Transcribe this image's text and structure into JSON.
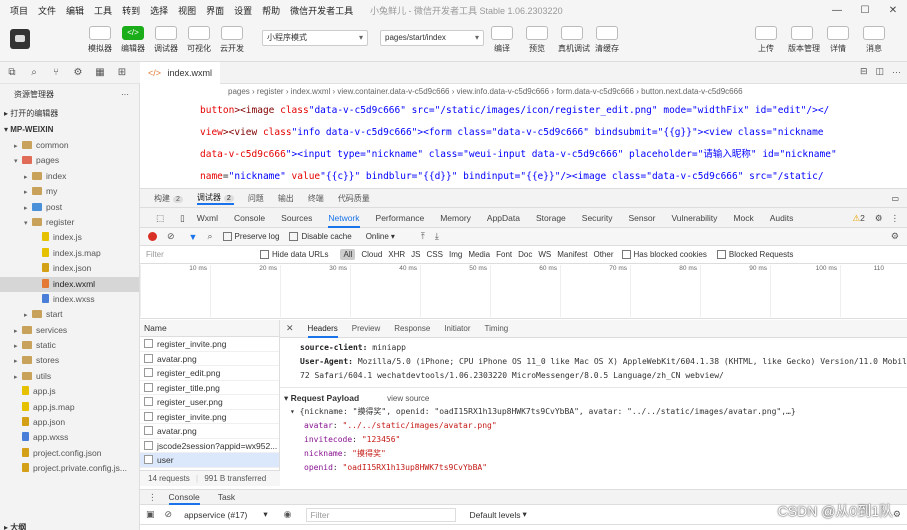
{
  "menu": [
    "项目",
    "文件",
    "编辑",
    "工具",
    "转到",
    "选择",
    "视图",
    "界面",
    "设置",
    "帮助",
    "微信开发者工具"
  ],
  "window_title": "小兔鲜儿 - 微信开发者工具 Stable 1.06.2303220",
  "toolbar": {
    "left_buttons": [
      {
        "label": "模拟器",
        "icon": "phone-icon"
      },
      {
        "label": "编辑器",
        "icon": "code-icon"
      },
      {
        "label": "调试器",
        "icon": "debug-icon"
      },
      {
        "label": "可视化",
        "icon": "visual-icon"
      },
      {
        "label": "云开发",
        "icon": "cloud-icon"
      }
    ],
    "mode_select": "小程序模式",
    "page_select": "pages/start/index",
    "mid_buttons": [
      {
        "label": "编译"
      },
      {
        "label": "预览"
      },
      {
        "label": "真机调试"
      },
      {
        "label": "清缓存"
      }
    ],
    "right_buttons": [
      {
        "label": "上传"
      },
      {
        "label": "版本管理"
      },
      {
        "label": "详情"
      },
      {
        "label": "消息"
      }
    ]
  },
  "sidebar": {
    "title": "资源管理器",
    "open_editors": "打开的编辑器",
    "project": "MP-WEIXIN",
    "tree": [
      {
        "label": "common",
        "indent": 1,
        "type": "folder",
        "arrow": "▸"
      },
      {
        "label": "pages",
        "indent": 1,
        "type": "folder-red",
        "arrow": "▾"
      },
      {
        "label": "index",
        "indent": 2,
        "type": "folder",
        "arrow": "▸"
      },
      {
        "label": "my",
        "indent": 2,
        "type": "folder",
        "arrow": "▸"
      },
      {
        "label": "post",
        "indent": 2,
        "type": "folder-blue",
        "arrow": "▸"
      },
      {
        "label": "register",
        "indent": 2,
        "type": "folder",
        "arrow": "▾"
      },
      {
        "label": "index.js",
        "indent": 3,
        "type": "js",
        "arrow": ""
      },
      {
        "label": "index.js.map",
        "indent": 3,
        "type": "js",
        "arrow": ""
      },
      {
        "label": "index.json",
        "indent": 3,
        "type": "json",
        "arrow": ""
      },
      {
        "label": "index.wxml",
        "indent": 3,
        "type": "wxml",
        "arrow": "",
        "active": true
      },
      {
        "label": "index.wxss",
        "indent": 3,
        "type": "wxss",
        "arrow": ""
      },
      {
        "label": "start",
        "indent": 2,
        "type": "folder",
        "arrow": "▸"
      },
      {
        "label": "services",
        "indent": 1,
        "type": "folder",
        "arrow": "▸"
      },
      {
        "label": "static",
        "indent": 1,
        "type": "folder",
        "arrow": "▸"
      },
      {
        "label": "stores",
        "indent": 1,
        "type": "folder",
        "arrow": "▸"
      },
      {
        "label": "utils",
        "indent": 1,
        "type": "folder",
        "arrow": "▸"
      },
      {
        "label": "app.js",
        "indent": 1,
        "type": "js",
        "arrow": ""
      },
      {
        "label": "app.js.map",
        "indent": 1,
        "type": "js",
        "arrow": ""
      },
      {
        "label": "app.json",
        "indent": 1,
        "type": "json",
        "arrow": ""
      },
      {
        "label": "app.wxss",
        "indent": 1,
        "type": "wxss",
        "arrow": ""
      },
      {
        "label": "project.config.json",
        "indent": 1,
        "type": "json",
        "arrow": ""
      },
      {
        "label": "project.private.config.js...",
        "indent": 1,
        "type": "json",
        "arrow": ""
      }
    ],
    "bottom": "大纲"
  },
  "editor": {
    "tab": "index.wxml",
    "breadcrumb": [
      "pages",
      "register",
      "index.wxml",
      "view.container.data-v-c5d9c666",
      "view.info.data-v-c5d9c666",
      "form.data-v-c5d9c666",
      "button.next.data-v-c5d9c666"
    ],
    "code_lines": [
      "button><image class=\"data-v-c5d9c666\" src=\"/static/images/icon/register_edit.png\" mode=\"widthFix\" id=\"edit\"/></",
      "view><view class=\"info data-v-c5d9c666\"><form class=\"data-v-c5d9c666\" bindsubmit=\"{{g}}\"><view class=\"nickname",
      "data-v-c5d9c666\"><input type=\"nickname\" class=\"weui-input data-v-c5d9c666\" placeholder=\"请输入昵称\" id=\"nickname\"",
      "name=\"nickname\" value=\"{{c}}\" bindblur=\"{{d}}\" bindinput=\"{{e}}\"/><image class=\"data-v-c5d9c666\" src=\"/static/"
    ]
  },
  "devtools": {
    "top_tabs": [
      {
        "label": "构建",
        "badge": "2"
      },
      {
        "label": "调试器",
        "badge": "2"
      },
      {
        "label": "问题",
        "badge": ""
      },
      {
        "label": "输出",
        "badge": ""
      },
      {
        "label": "终端",
        "badge": ""
      },
      {
        "label": "代码质量",
        "badge": ""
      }
    ],
    "panel_tabs": [
      "Wxml",
      "Console",
      "Sources",
      "Network",
      "Performance",
      "Memory",
      "AppData",
      "Storage",
      "Security",
      "Sensor",
      "Vulnerability",
      "Mock",
      "Audits"
    ],
    "active_panel": "Network",
    "warnings": "2",
    "net_toolbar": {
      "preserve_log": "Preserve log",
      "disable_cache": "Disable cache",
      "throttle": "Online"
    },
    "filter": {
      "placeholder": "Filter",
      "hide_data_urls": "Hide data URLs",
      "types": [
        "All",
        "Cloud",
        "XHR",
        "JS",
        "CSS",
        "Img",
        "Media",
        "Font",
        "Doc",
        "WS",
        "Manifest",
        "Other"
      ],
      "blocked_cookies": "Has blocked cookies",
      "blocked_requests": "Blocked Requests"
    },
    "timeline_ticks": [
      "10 ms",
      "20 ms",
      "30 ms",
      "40 ms",
      "50 ms",
      "60 ms",
      "70 ms",
      "80 ms",
      "90 ms",
      "100 ms",
      "110"
    ],
    "request_list": {
      "header": "Name",
      "items": [
        "register_invite.png",
        "avatar.png",
        "register_edit.png",
        "register_title.png",
        "register_user.png",
        "register_invite.png",
        "avatar.png",
        "jscode2session?appid=wx952...",
        "user"
      ],
      "selected_index": 8,
      "footer_requests": "14 requests",
      "footer_transferred": "991 B transferred"
    },
    "detail": {
      "tabs": [
        "Headers",
        "Preview",
        "Response",
        "Initiator",
        "Timing"
      ],
      "active_tab": "Headers",
      "source_client_key": "source-client:",
      "source_client_val": "miniapp",
      "ua_key": "User-Agent:",
      "ua_val": "Mozilla/5.0 (iPhone; CPU iPhone OS 11_0 like Mac OS X) AppleWebKit/604.1.38 (KHTML, like Gecko) Version/11.0 Mobile/15A3",
      "ua_val2": "72 Safari/604.1 wechatdevtools/1.06.2303220 MicroMessenger/8.0.5 Language/zh_CN webview/",
      "payload_title": "Request Payload",
      "view_source": "view source",
      "payload_summary": "{nickname: \"摸得奖\", openid: \"oadI15RX1h13up8HWK7ts9CvYbBA\", avatar: \"../../static/images/avatar.png\",…}",
      "payload": [
        {
          "key": "avatar",
          "val": "\"../../static/images/avatar.png\""
        },
        {
          "key": "invitecode",
          "val": "\"123456\""
        },
        {
          "key": "nickname",
          "val": "\"摸得奖\""
        },
        {
          "key": "openid",
          "val": "\"oadI15RX1h13up8HWK7ts9CvYbBA\""
        }
      ]
    },
    "console_tabs": [
      "Console",
      "Task"
    ],
    "console_context": "appservice (#17)",
    "console_filter": "Filter",
    "console_levels": "Default levels"
  },
  "watermark": "CSDN @从0到1队",
  "colors": {
    "accent": "#1a73e8",
    "green": "#1aad19",
    "tag": "#800000",
    "attr": "#e50000",
    "string": "#0000ff"
  }
}
